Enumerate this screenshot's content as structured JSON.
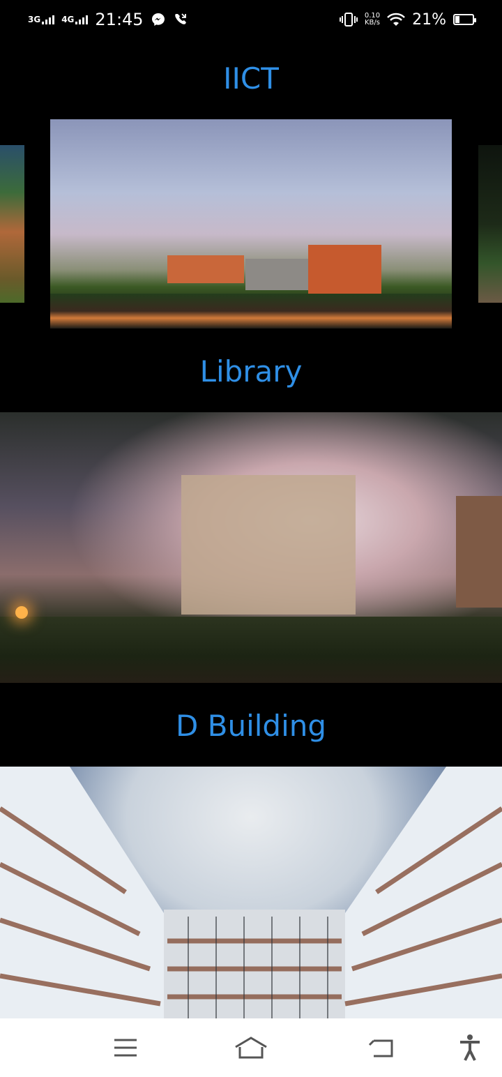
{
  "status_bar": {
    "network_1": "3G",
    "network_2": "4G",
    "time": "21:45",
    "speed_value": "0.10",
    "speed_unit": "KB/s",
    "battery": "21%"
  },
  "sections": [
    {
      "title": "IICT",
      "image": "IICT building with palm trees"
    },
    {
      "title": "Library",
      "image": "Library building at dusk"
    },
    {
      "title": "D Building",
      "image": "D Building courtyard"
    }
  ],
  "nav": {
    "menu_icon": "menu-icon",
    "home_icon": "home-icon",
    "back_icon": "back-icon",
    "accessibility_icon": "accessibility-icon"
  },
  "colors": {
    "accent": "#2f8fe6",
    "background": "#000000"
  }
}
